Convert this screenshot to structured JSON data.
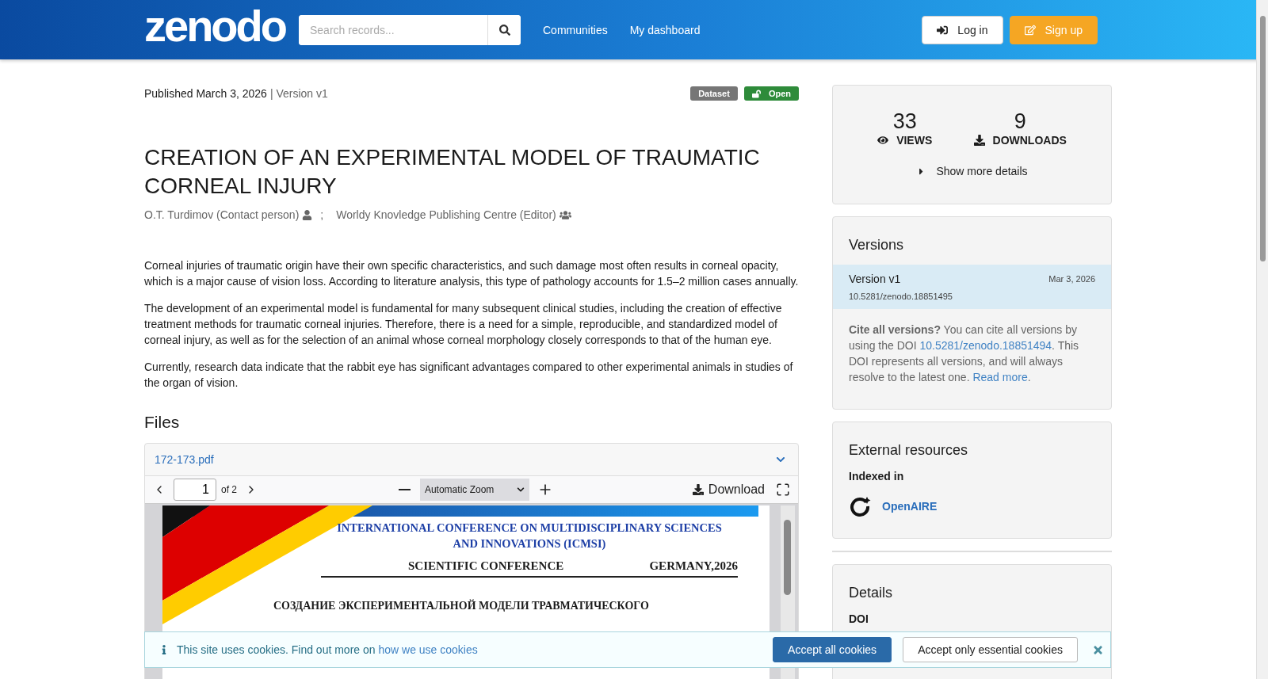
{
  "header": {
    "logo": "zenodo",
    "search": {
      "placeholder": "Search records..."
    },
    "nav": [
      "Communities",
      "My dashboard"
    ],
    "buttons": [
      {
        "label": "Log in",
        "kind": "login"
      },
      {
        "label": "Sign up",
        "kind": "signup"
      }
    ]
  },
  "record": {
    "published": "Published March 3, 2026",
    "version": "| Version v1",
    "badges": [
      {
        "label": "Dataset",
        "kind": "type"
      },
      {
        "label": "Open",
        "kind": "access"
      }
    ],
    "title": "CREATION OF AN EXPERIMENTAL MODEL OF TRAUMATIC CORNEAL INJURY",
    "creators": [
      {
        "name": "O.T. Turdimov (Contact person)",
        "kind": "person"
      },
      {
        "name": "Worldy Knovledge Publishing Centre (Editor)",
        "kind": "group"
      }
    ],
    "creator_separator": ";",
    "description": [
      "Corneal injuries of traumatic origin have their own specific characteristics, and such damage most often results in corneal opacity, which is a major cause of vision loss. According to literature analysis, this type of pathology accounts for 1.5–2 million cases annually.",
      "The development of an experimental model is fundamental for many subsequent clinical studies, including the creation of effective treatment methods for traumatic corneal injuries. Therefore, there is a need for a simple, reproducible, and standardized model of corneal injury, as well as for the selection of an animal whose corneal morphology closely corresponds to that of the human eye.",
      "Currently, research data indicate that the rabbit eye has significant advantages compared to other experimental animals in studies of the organ of vision."
    ]
  },
  "files": {
    "heading": "Files",
    "file_name": "172-173.pdf",
    "expanded": true,
    "viewer": {
      "page": "1",
      "page_count": "of 2",
      "zoom": "Automatic Zoom",
      "download": "Download",
      "document": {
        "conference": [
          "INTERNATIONAL CONFERENCE ON MULTIDISCIPLINARY SCIENCES",
          "AND INNOVATIONS (ICMSI)"
        ],
        "left": "SCIENTIFIC CONFERENCE",
        "right": "GERMANY,2026",
        "title_line": "СОЗДАНИЕ ЭКСПЕРИМЕНТАЛЬНОЙ МОДЕЛИ ТРАВМАТИЧЕСКОГО"
      }
    }
  },
  "sidebar": {
    "stats": [
      {
        "value": "33",
        "label": "VIEWS",
        "kind": "views"
      },
      {
        "value": "9",
        "label": "DOWNLOADS",
        "kind": "downloads"
      }
    ],
    "show_more": "Show more details",
    "versions": {
      "heading": "Versions",
      "items": [
        {
          "name": "Version v1",
          "date": "Mar 3, 2026",
          "doi": "10.5281/zenodo.18851495",
          "selected": true
        }
      ],
      "cite": {
        "lead": "Cite all versions?",
        "text1": "You can cite all versions by using the DOI",
        "doi": "10.5281/zenodo.18851494",
        "text2": ". This DOI represents all versions, and will always resolve to the latest one.",
        "read_more": "Read more",
        "end": "."
      }
    },
    "external": {
      "heading": "External resources",
      "subheading": "Indexed in",
      "items": [
        "OpenAIRE"
      ]
    },
    "details": {
      "heading": "Details",
      "fields": [
        "DOI"
      ]
    }
  },
  "cookie_banner": {
    "text": "This site uses cookies. Find out more on",
    "link": "how we use cookies",
    "buttons": [
      {
        "label": "Accept all cookies",
        "kind": "primary"
      },
      {
        "label": "Accept only essential cookies",
        "kind": "secondary"
      }
    ]
  }
}
